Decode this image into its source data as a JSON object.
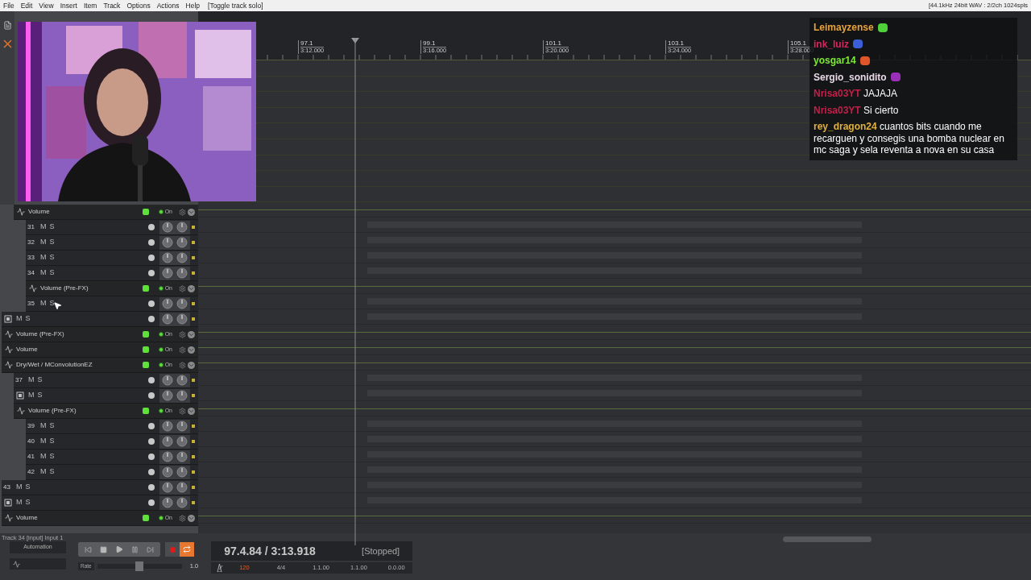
{
  "menu": {
    "items": [
      "File",
      "Edit",
      "View",
      "Insert",
      "Item",
      "Track",
      "Options",
      "Actions",
      "Help"
    ],
    "action_hint": "[Toggle track solo]",
    "device_info": "[44.1kHz 24bit WAV : 2/2ch 1024spls"
  },
  "ruler": {
    "markers": [
      {
        "bar": "97.1",
        "time": "3:12.000"
      },
      {
        "bar": "99.1",
        "time": "3:16.000"
      },
      {
        "bar": "101.1",
        "time": "3:20.000"
      },
      {
        "bar": "103.1",
        "time": "3:24.000"
      },
      {
        "bar": "105.1",
        "time": "3:28.000"
      }
    ]
  },
  "tracks": [
    {
      "kind": "group",
      "children": [
        {
          "kind": "envelope",
          "name": "Volume",
          "toggle": "On"
        },
        {
          "kind": "group",
          "children": [
            {
              "kind": "track",
              "number": "31",
              "mute": "M",
              "solo": "S"
            },
            {
              "kind": "track",
              "number": "32",
              "mute": "M",
              "solo": "S"
            },
            {
              "kind": "track",
              "number": "33",
              "mute": "M",
              "solo": "S"
            },
            {
              "kind": "track",
              "number": "34",
              "mute": "M",
              "solo": "S"
            },
            {
              "kind": "envelope",
              "name": "Volume (Pre-FX)",
              "toggle": "On"
            },
            {
              "kind": "track",
              "number": "35",
              "mute": "M",
              "solo": "S"
            }
          ]
        }
      ]
    },
    {
      "kind": "track",
      "mute": "M",
      "solo": "S"
    },
    {
      "kind": "envelope",
      "name": "Volume (Pre-FX)",
      "toggle": "On"
    },
    {
      "kind": "envelope",
      "name": "Volume",
      "toggle": "On"
    },
    {
      "kind": "envelope",
      "name": "Dry/Wet / MConvolutionEZ",
      "toggle": "On"
    },
    {
      "kind": "group",
      "children": [
        {
          "kind": "track",
          "number": "37",
          "mute": "M",
          "solo": "S"
        },
        {
          "kind": "track",
          "mute": "M",
          "solo": "S"
        },
        {
          "kind": "envelope",
          "name": "Volume (Pre-FX)",
          "toggle": "On"
        },
        {
          "kind": "group",
          "children": [
            {
              "kind": "track",
              "number": "39",
              "mute": "M",
              "solo": "S"
            },
            {
              "kind": "track",
              "number": "40",
              "mute": "M",
              "solo": "S"
            },
            {
              "kind": "track",
              "number": "41",
              "mute": "M",
              "solo": "S"
            },
            {
              "kind": "track",
              "number": "42",
              "mute": "M",
              "solo": "S"
            }
          ]
        }
      ]
    },
    {
      "kind": "track",
      "number": "43",
      "mute": "M",
      "solo": "S"
    },
    {
      "kind": "track",
      "mute": "M",
      "solo": "S"
    },
    {
      "kind": "envelope",
      "name": "Volume",
      "toggle": "On"
    }
  ],
  "chat": {
    "messages": [
      {
        "user": "Leimayzense",
        "color": "#e8a33c",
        "emote": {
          "color": "#4fd13a"
        }
      },
      {
        "user": "ink_luiz",
        "color": "#d4285e",
        "emote": {
          "color": "#3b5fd6"
        }
      },
      {
        "user": "yosgar14",
        "color": "#7ee83a",
        "emote": {
          "color": "#e0562a"
        }
      },
      {
        "user": "Sergio_sonidito",
        "color": "#e8d8e8",
        "emote": {
          "color": "#9a2fb8"
        }
      },
      {
        "user": "Nrisa03YT",
        "color": "#c2204a",
        "text": "JAJAJA"
      },
      {
        "user": "Nrisa03YT",
        "color": "#c2204a",
        "text": "Si cierto"
      },
      {
        "user": "rey_dragon24",
        "color": "#e0b040",
        "text": "cuantos bits cuando me recarguen y consegis una bomba nuclear en mc saga y sela reventa a nova en su casa"
      }
    ]
  },
  "status": "Track 34 [input] Input 1",
  "transport": {
    "automation": "Automation",
    "repeat": {
      "on": true
    },
    "rate_label": "Rate",
    "rate": {
      "level": 0.5
    },
    "rate_value": "1.0",
    "position": "97.4.84 / 3:13.918",
    "state": "[Stopped]",
    "tempo": "120",
    "time_signature": "4/4",
    "fields": [
      "1.1.00",
      "1.1.00",
      "0.0.00"
    ]
  }
}
